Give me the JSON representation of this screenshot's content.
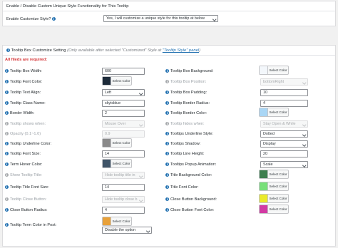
{
  "top_section": {
    "title": "Enable / Disable Custom Unique Style Functionality for This Tooltip",
    "enable_label": "Enable Customize Style?",
    "enable_value": "Yes, I will customize a unique style for this tooltip at below"
  },
  "customize_section": {
    "title": "Tooltip Box Customize Setting",
    "note": "(Only available after selected \"Customized\" Style at",
    "note_link": "\"Tooltip Style\" panel",
    "note_end": ")",
    "required_note": "All fileds are required:"
  },
  "select_color_label": "Select Color",
  "left_fields": [
    {
      "label": "Tooltip Box Width:",
      "type": "text",
      "value": "600"
    },
    {
      "label": "Tooltip Font Color:",
      "type": "color",
      "color": "#1d2b3a"
    },
    {
      "label": "Tooltip Text Align:",
      "type": "select",
      "value": "Left"
    },
    {
      "label": "Tooltip Class Name:",
      "type": "text",
      "value": "skyisblue"
    },
    {
      "label": "Border Width:",
      "type": "text",
      "value": "2"
    },
    {
      "label": "Tooltip shows when:",
      "type": "select",
      "value": "Mouse Over",
      "disabled": true
    },
    {
      "label": "Opacity (0.1~1.0)",
      "type": "text",
      "value": "0.9",
      "disabled": true
    },
    {
      "label": "Tooltip Underline Color:",
      "type": "color",
      "color": "#8a8a8a"
    },
    {
      "label": "Tooltip Font Size:",
      "type": "text",
      "value": "14"
    },
    {
      "label": "Term Hover Color:",
      "type": "color",
      "color": "#3f5468"
    },
    {
      "label": "Show Tooltip Title:",
      "type": "select",
      "value": "Hide tooltip title in",
      "disabled": true
    },
    {
      "label": "Tooltip Title Font Size:",
      "type": "text",
      "value": "14"
    },
    {
      "label": "Tooltip Close Button:",
      "type": "select",
      "value": "Hide tooltip close b",
      "disabled": true
    },
    {
      "label": "Close Button Radius:",
      "type": "text",
      "value": "4"
    }
  ],
  "right_fields": [
    {
      "label": "Tooltip Box Background:",
      "type": "color",
      "color": "#f3f7fb"
    },
    {
      "label": "Tooltip Box Position:",
      "type": "select",
      "value": "bottomRight",
      "disabled": true
    },
    {
      "label": "Tooltip Box Padding:",
      "type": "text",
      "value": "10"
    },
    {
      "label": "Tooltip Border Radius:",
      "type": "text",
      "value": "4"
    },
    {
      "label": "Tooltip Border Color:",
      "type": "color",
      "color": "#a9d6f5"
    },
    {
      "label": "Tooltip hides when:",
      "type": "select",
      "value": "Stay Open & While",
      "disabled": true
    },
    {
      "label": "Tooltips Underline Style:",
      "type": "select",
      "value": "Dotted"
    },
    {
      "label": "Tooltips Shadow:",
      "type": "select",
      "value": "Display"
    },
    {
      "label": "Tooltip Line Height:",
      "type": "text",
      "value": "20"
    },
    {
      "label": "Tooltips Popup Animation:",
      "type": "select",
      "value": "Scale"
    },
    {
      "label": "Title Background Color:",
      "type": "color",
      "color": "#3e7f4f"
    },
    {
      "label": "Title Font Color:",
      "type": "color",
      "color": "#78e07a"
    },
    {
      "label": "Close Button Background:",
      "type": "color",
      "color": "#eaea2a"
    },
    {
      "label": "Close Button Font Color:",
      "type": "color",
      "color": "#d23aa3"
    }
  ],
  "bottom_field": {
    "label": "Tooltip Term Color in Post:",
    "color": "#e8a13a",
    "select_value": "Disable the option"
  }
}
